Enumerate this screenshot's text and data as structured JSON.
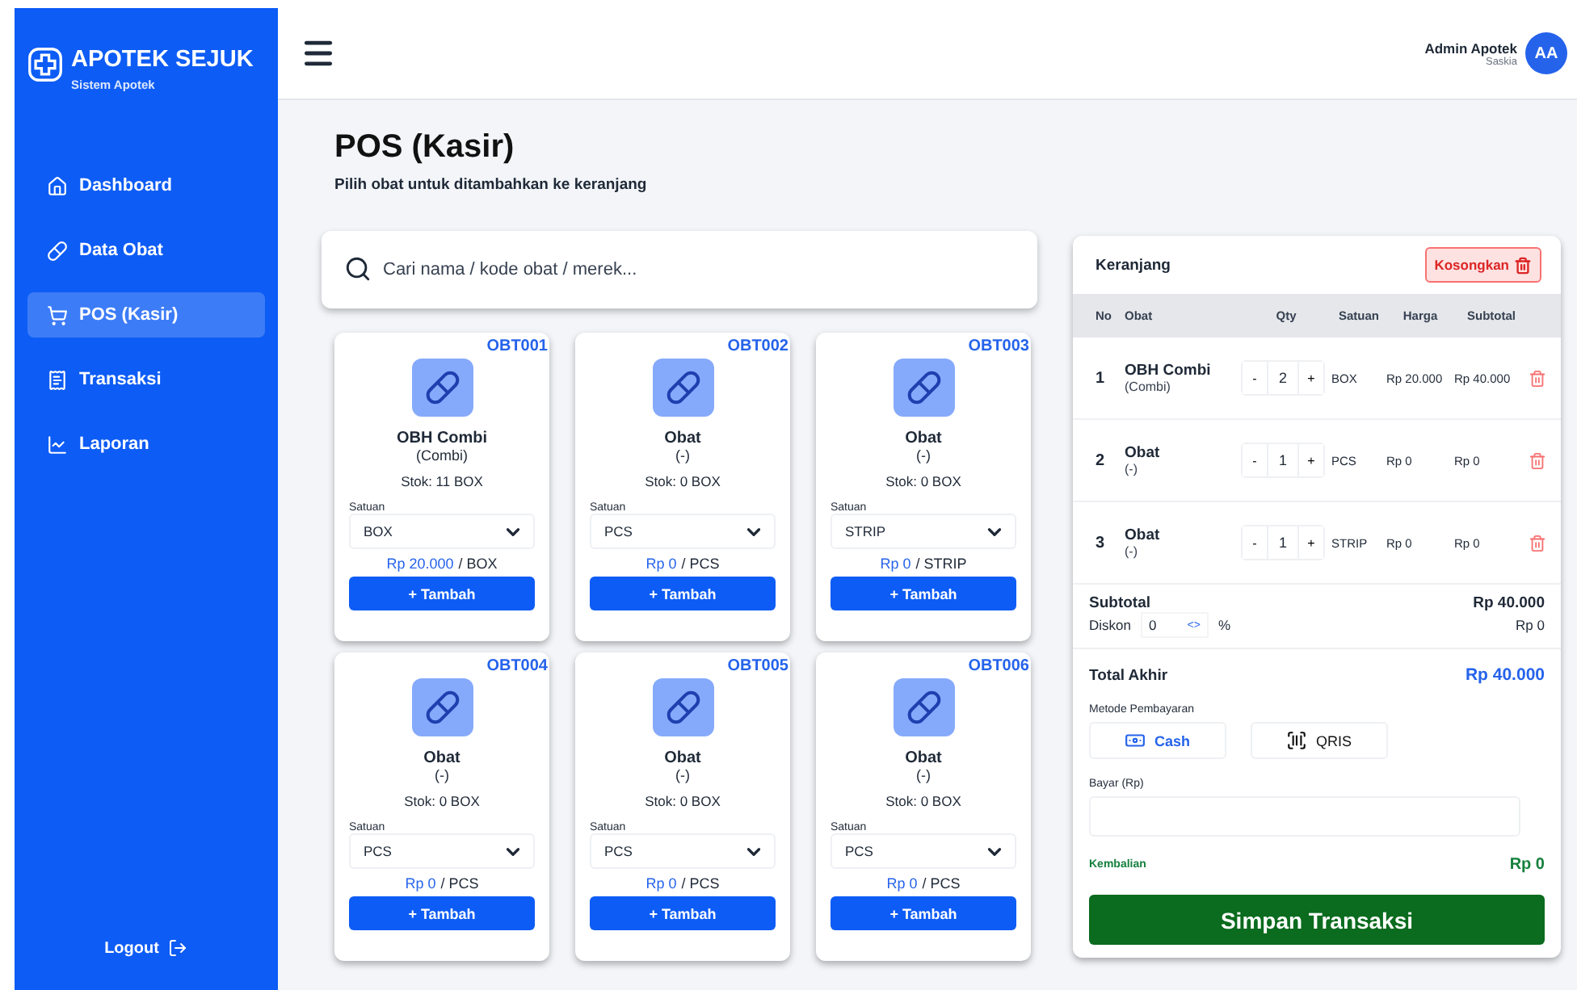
{
  "brand": {
    "name": "APOTEK SEJUK",
    "subtitle": "Sistem Apotek"
  },
  "nav": [
    {
      "label": "Dashboard",
      "kind": "home",
      "selected": false
    },
    {
      "label": "Data Obat",
      "kind": "pill",
      "selected": false
    },
    {
      "label": "POS (Kasir)",
      "kind": "cart",
      "selected": true
    },
    {
      "label": "Transaksi",
      "kind": "receipt",
      "selected": false
    },
    {
      "label": "Laporan",
      "kind": "chart",
      "selected": false
    }
  ],
  "logout": "Logout",
  "user": {
    "name": "Admin Apotek",
    "sub": "Saskia",
    "initials": "AA"
  },
  "page": {
    "title": "POS (Kasir)",
    "subtitle": "Pilih obat untuk ditambahkan ke keranjang"
  },
  "search": {
    "placeholder": "Cari nama / kode obat / merek..."
  },
  "products": [
    {
      "code": "OBT001",
      "name": "OBH Combi",
      "brand": "(Combi)",
      "stock": "Stok: 11 BOX",
      "unit_label": "Satuan",
      "unit": "BOX",
      "price": "Rp 20.000",
      "per": "/ BOX",
      "button": "+ Tambah"
    },
    {
      "code": "OBT002",
      "name": "Obat",
      "brand": "(-)",
      "stock": "Stok: 0 BOX",
      "unit_label": "Satuan",
      "unit": "PCS",
      "price": "Rp 0",
      "per": "/ PCS",
      "button": "+ Tambah"
    },
    {
      "code": "OBT003",
      "name": "Obat",
      "brand": "(-)",
      "stock": "Stok: 0 BOX",
      "unit_label": "Satuan",
      "unit": "STRIP",
      "price": "Rp 0",
      "per": "/ STRIP",
      "button": "+ Tambah"
    },
    {
      "code": "OBT004",
      "name": "Obat",
      "brand": "(-)",
      "stock": "Stok: 0 BOX",
      "unit_label": "Satuan",
      "unit": "PCS",
      "price": "Rp 0",
      "per": "/ PCS",
      "button": "+ Tambah"
    },
    {
      "code": "OBT005",
      "name": "Obat",
      "brand": "(-)",
      "stock": "Stok: 0 BOX",
      "unit_label": "Satuan",
      "unit": "PCS",
      "price": "Rp 0",
      "per": "/ PCS",
      "button": "+ Tambah"
    },
    {
      "code": "OBT006",
      "name": "Obat",
      "brand": "(-)",
      "stock": "Stok: 0 BOX",
      "unit_label": "Satuan",
      "unit": "PCS",
      "price": "Rp 0",
      "per": "/ PCS",
      "button": "+ Tambah"
    }
  ],
  "cart": {
    "title": "Keranjang",
    "clear": "Kosongkan",
    "columns": [
      "No",
      "Obat",
      "Qty",
      "Satuan",
      "Harga",
      "Subtotal"
    ],
    "rows": [
      {
        "no": "1",
        "name": "OBH Combi",
        "brand": "(Combi)",
        "minus": "-",
        "qty": "2",
        "plus": "+",
        "unit": "BOX",
        "price": "Rp 20.000",
        "subtotal": "Rp 40.000"
      },
      {
        "no": "2",
        "name": "Obat",
        "brand": "(-)",
        "minus": "-",
        "qty": "1",
        "plus": "+",
        "unit": "PCS",
        "price": "Rp 0",
        "subtotal": "Rp 0"
      },
      {
        "no": "3",
        "name": "Obat",
        "brand": "(-)",
        "minus": "-",
        "qty": "1",
        "plus": "+",
        "unit": "STRIP",
        "price": "Rp 0",
        "subtotal": "Rp 0"
      }
    ],
    "subtotal_label": "Subtotal",
    "subtotal": "Rp 40.000",
    "discount_label": "Diskon",
    "discount_value": "0",
    "discount_spin": "<>",
    "discount_unit": "%",
    "discount_amount": "Rp 0",
    "total_label": "Total Akhir",
    "total": "Rp 40.000",
    "payment_label": "Metode Pembayaran",
    "payment_methods": [
      {
        "label": "Cash",
        "kind": "cash",
        "selected": true
      },
      {
        "label": "QRIS",
        "kind": "qr",
        "selected": false
      }
    ],
    "pay_label": "Bayar (Rp)",
    "change_label": "Kembalian",
    "change": "Rp 0",
    "save": "Simpan Transaksi"
  }
}
